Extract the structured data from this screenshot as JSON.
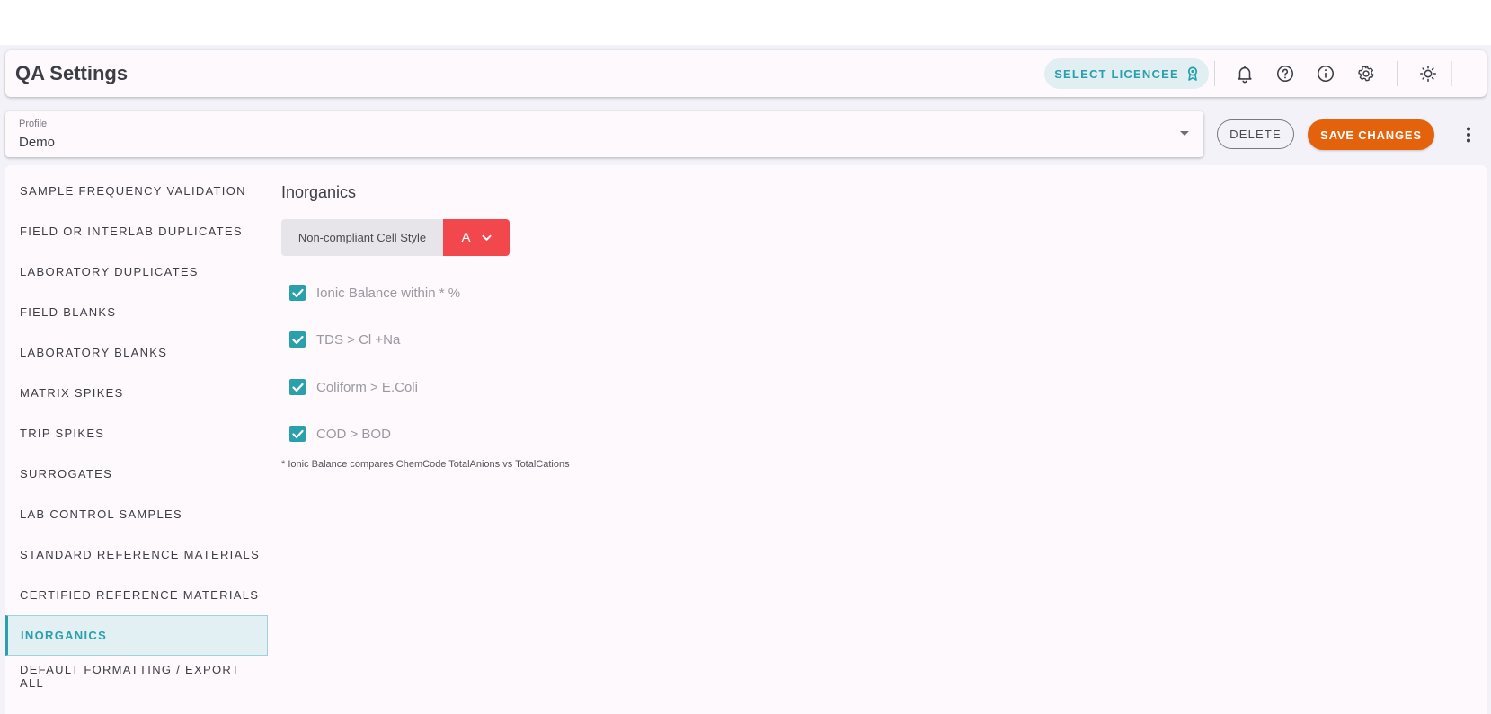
{
  "header": {
    "title": "QA Settings",
    "licencee_label": "SELECT LICENCEE"
  },
  "icons": {
    "licencee": "award-icon",
    "notifications": "bell-icon",
    "help": "question-circle-icon",
    "info": "info-circle-icon",
    "settings": "gear-icon",
    "theme": "sun-icon",
    "more": "kebab-vertical-icon"
  },
  "profile": {
    "label": "Profile",
    "value": "Demo"
  },
  "actions": {
    "delete_label": "DELETE",
    "save_label": "SAVE CHANGES"
  },
  "sidebar": {
    "items": [
      {
        "label": "SAMPLE FREQUENCY VALIDATION",
        "active": false
      },
      {
        "label": "FIELD OR INTERLAB DUPLICATES",
        "active": false
      },
      {
        "label": "LABORATORY DUPLICATES",
        "active": false
      },
      {
        "label": "FIELD BLANKS",
        "active": false
      },
      {
        "label": "LABORATORY BLANKS",
        "active": false
      },
      {
        "label": "MATRIX SPIKES",
        "active": false
      },
      {
        "label": "TRIP SPIKES",
        "active": false
      },
      {
        "label": "SURROGATES",
        "active": false
      },
      {
        "label": "LAB CONTROL SAMPLES",
        "active": false
      },
      {
        "label": "STANDARD REFERENCE MATERIALS",
        "active": false
      },
      {
        "label": "CERTIFIED REFERENCE MATERIALS",
        "active": false
      },
      {
        "label": "INORGANICS",
        "active": true
      },
      {
        "label": "DEFAULT FORMATTING / EXPORT ALL",
        "active": false
      }
    ]
  },
  "main": {
    "section_title": "Inorganics",
    "cell_style": {
      "label": "Non-compliant Cell Style",
      "value": "A",
      "color": "#f2474c"
    },
    "checks": [
      {
        "label": "Ionic Balance within * %",
        "checked": true
      },
      {
        "label": "TDS > Cl +Na",
        "checked": true
      },
      {
        "label": "Coliform > E.Coli",
        "checked": true
      },
      {
        "label": "COD > BOD",
        "checked": true
      }
    ],
    "footnote": "* Ionic Balance compares ChemCode TotalAnions vs TotalCations"
  },
  "colors": {
    "accent": "#2aa0ac",
    "primary_action": "#e3620b",
    "background": "#f3f2f8",
    "card": "#fdf9fd"
  }
}
